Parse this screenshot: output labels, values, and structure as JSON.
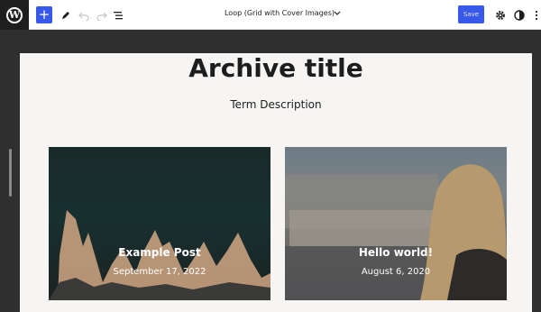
{
  "toolbar": {
    "logo_glyph": "W",
    "add_label": "+",
    "document_title": "Loop (Grid with Cover Images)",
    "save_label": "Save",
    "icons": [
      "wordpress-logo",
      "plus",
      "pencil",
      "undo",
      "redo",
      "list-view",
      "chevron-down",
      "gear",
      "half-circle",
      "more-vertical"
    ]
  },
  "canvas": {
    "archive_title": "Archive title",
    "term_description": "Term Description"
  },
  "posts": [
    {
      "title": "Example Post",
      "date": "September 17, 2022"
    },
    {
      "title": "Hello world!",
      "date": "August 6, 2020"
    }
  ],
  "colors": {
    "accent": "#3858e9",
    "canvas_bg": "#f6f5f3",
    "editor_bg": "#2f2f2f"
  }
}
